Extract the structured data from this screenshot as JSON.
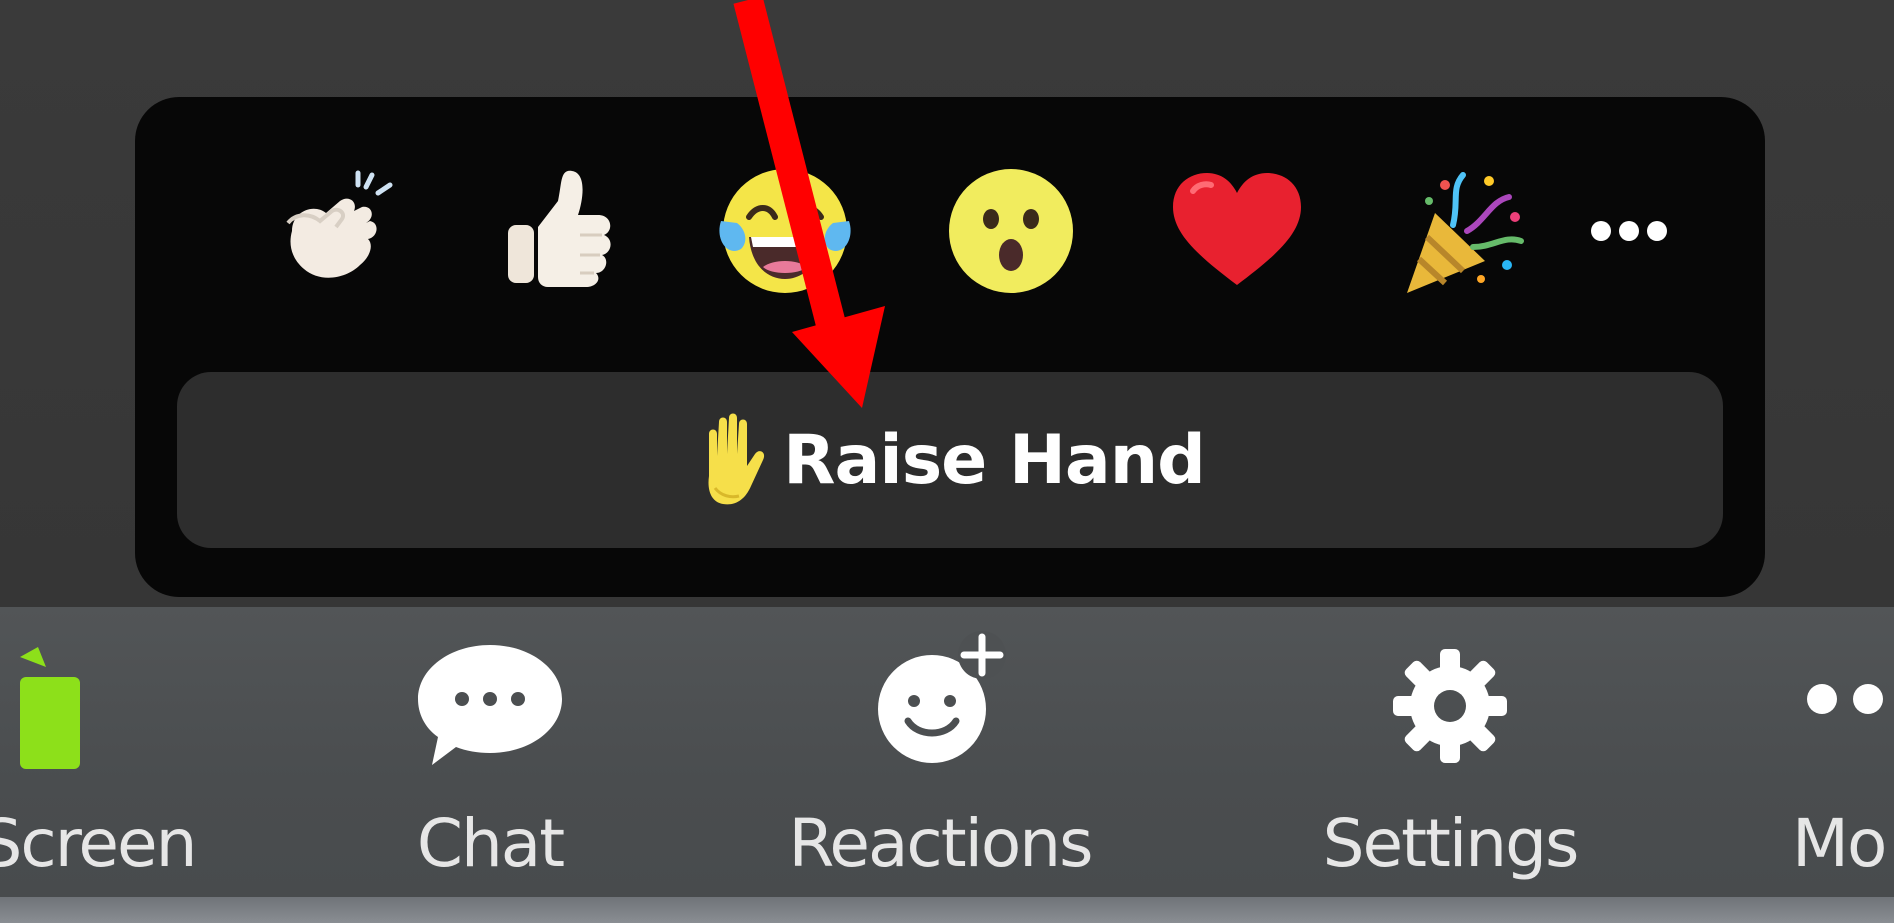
{
  "reactions_popup": {
    "emojis": [
      {
        "name": "clapping-hands",
        "label": "👏"
      },
      {
        "name": "thumbs-up",
        "label": "👍"
      },
      {
        "name": "tears-of-joy",
        "label": "😂"
      },
      {
        "name": "open-mouth",
        "label": "😮"
      },
      {
        "name": "red-heart",
        "label": "❤️"
      },
      {
        "name": "party-popper",
        "label": "🎉"
      }
    ],
    "more_label": "•••",
    "raise_hand": {
      "icon": "raised-hand-icon",
      "label": "Raise Hand"
    }
  },
  "toolbar": {
    "items": [
      {
        "label": "Screen",
        "icon": "share-screen-icon"
      },
      {
        "label": "Chat",
        "icon": "chat-icon"
      },
      {
        "label": "Reactions",
        "icon": "add-reaction-icon"
      },
      {
        "label": "Settings",
        "icon": "gear-icon"
      },
      {
        "label": "Mo",
        "icon": "more-icon"
      }
    ]
  },
  "colors": {
    "popup_background": "#070707",
    "raise_hand_button": "#2d2d2d",
    "toolbar_background": "#4c4f51",
    "share_screen_accent": "#8de01a",
    "annotation_arrow": "#ff0000"
  }
}
